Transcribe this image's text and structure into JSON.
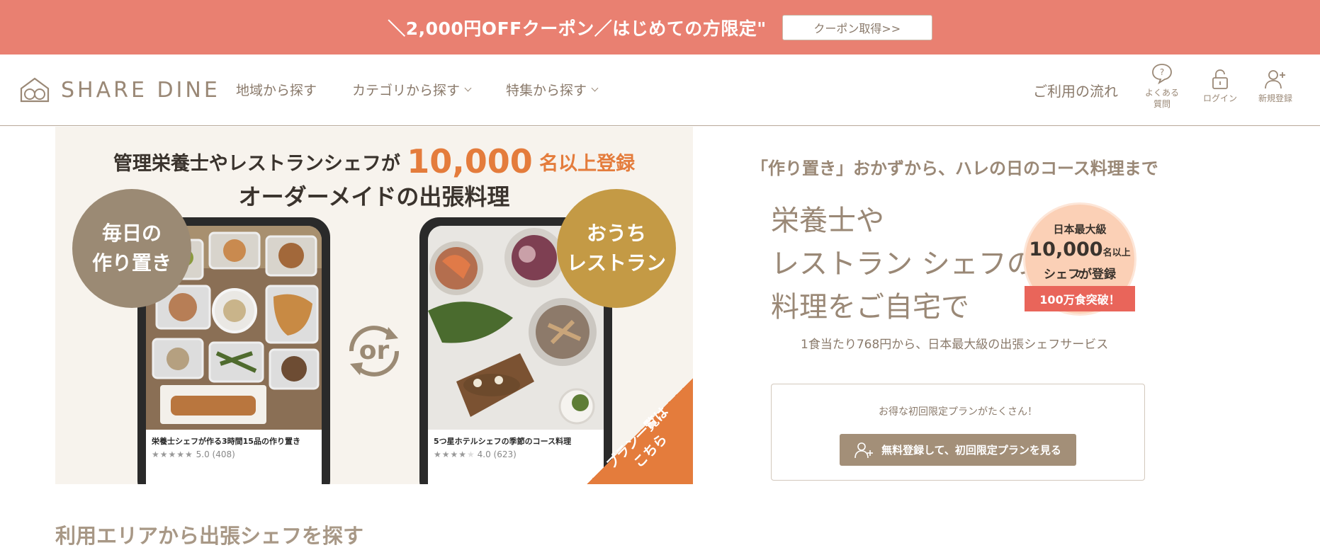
{
  "promo": {
    "text": "＼2,000円OFFクーポン／はじめての方限定\"",
    "button": "クーポン取得>>"
  },
  "header": {
    "logo_text": "SHARE DINE",
    "nav": [
      {
        "label": "地域から探す",
        "dropdown": false
      },
      {
        "label": "カテゴリから探す",
        "dropdown": true
      },
      {
        "label": "特集から探す",
        "dropdown": true
      }
    ],
    "flow_link": "ご利用の流れ",
    "faq_line1": "よくある",
    "faq_line2": "質問",
    "login": "ログイン",
    "register": "新規登録"
  },
  "hero": {
    "headline_pre": "管理栄養士やレストランシェフが",
    "headline_num": "10,000",
    "headline_post": "名以上登録",
    "headline2": "オーダーメイドの出張料理",
    "left_circle_1": "毎日の",
    "left_circle_2": "作り置き",
    "right_circle_1": "おうち",
    "right_circle_2": "レストラン",
    "or_label": "or",
    "left_caption": "栄養士シェフが作る3時間15品の作り置き",
    "left_rating": "5.0 (408)",
    "left_stars": 5,
    "right_caption": "5つ星ホテルシェフの季節のコース料理",
    "right_rating": "4.0 (623)",
    "right_stars": 4,
    "corner_1": "プラン一覧は",
    "corner_2": "こちら"
  },
  "intro": {
    "tagline": "「作り置き」おかずから、ハレの日のコース料理まで",
    "main_1": "栄養士や",
    "main_2": "レストラン シェフの",
    "main_3": "料理をご自宅で",
    "badge_1": "日本最大級",
    "badge_num": "10,000",
    "badge_num_suffix": "名以上の",
    "badge_3": "シェフが登録",
    "ribbon": "100万食突破！",
    "subcopy": "1食当たり768円から、日本最大級の出張シェフサービス"
  },
  "cta": {
    "text": "お得な初回限定プランがたくさん！",
    "button": "無料登録して、初回限定プランを見る"
  },
  "section": {
    "area_title": "利用エリアから出張シェフを探す"
  },
  "colors": {
    "promo": "#e98071",
    "brand": "#9a8876",
    "accent": "#e47c3c",
    "circle_left": "#9b8a74",
    "circle_right": "#c49a45",
    "ribbon": "#e9655a"
  }
}
